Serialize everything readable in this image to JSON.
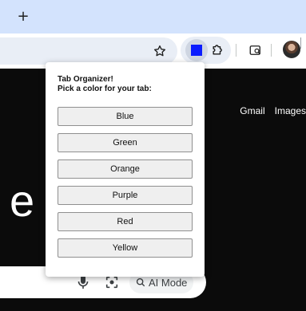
{
  "tabstrip": {
    "new_tab_label": "+"
  },
  "toolbar": {
    "icons": [
      "star-icon",
      "extension-square-icon",
      "puzzle-icon",
      "tab-search-icon",
      "profile-avatar"
    ],
    "extension_color": "#0b1cff"
  },
  "page": {
    "gbar_links": [
      "Gmail",
      "Images"
    ],
    "logo_fragment": "e",
    "ai_mode_label": "AI Mode"
  },
  "popup": {
    "title": "Tab Organizer!",
    "prompt": "Pick a color for your tab:",
    "buttons": [
      "Blue",
      "Green",
      "Orange",
      "Purple",
      "Red",
      "Yellow"
    ]
  }
}
